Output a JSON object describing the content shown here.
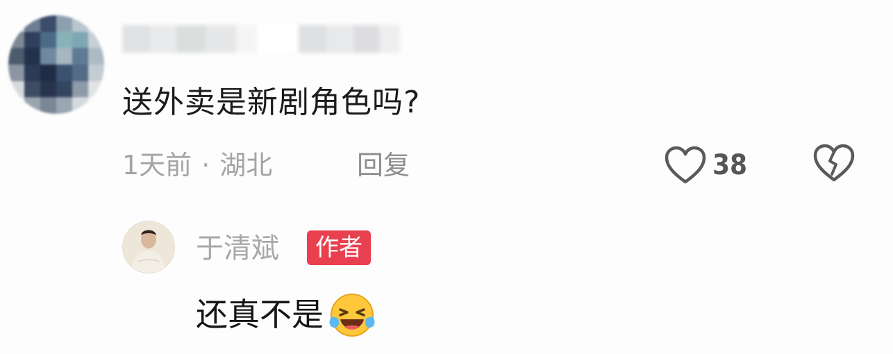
{
  "comment": {
    "text": "送外卖是新剧角色吗?",
    "time": "1天前",
    "separator": "·",
    "location": "湖北",
    "reply_label": "回复",
    "likes": "38",
    "icons": {
      "like": "heart-outline-icon",
      "dislike": "broken-heart-icon"
    }
  },
  "reply": {
    "author": "于清斌",
    "badge": "作者",
    "text": "还真不是",
    "emoji": "laughing-crying-emoji"
  },
  "colors": {
    "badge_bg": "#e8404f",
    "meta_text": "#a4a4a4",
    "body_text": "#1b1b1b"
  }
}
